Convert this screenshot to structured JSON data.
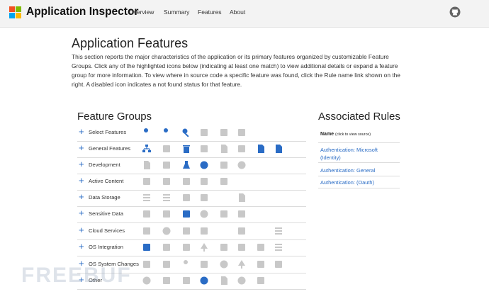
{
  "app": {
    "title": "Application Inspector",
    "nav": [
      {
        "label": "Overview"
      },
      {
        "label": "Summary"
      },
      {
        "label": "Features"
      },
      {
        "label": "About"
      }
    ],
    "logo_colors": [
      "#f25022",
      "#7fba00",
      "#00a4ef",
      "#ffb900"
    ]
  },
  "page": {
    "title": "Application Features",
    "intro": "This section reports the major characteristics of the application or its primary features organized by customizable Feature Groups. Click any of the highlighted icons below (indicating at least one match) to view additional details or expand a feature group for more information. To view where in source code a specific feature was found, click the Rule name link shown on the right. A disabled icon indicates a not found status for that feature."
  },
  "feature_groups": {
    "title": "Feature Groups",
    "expand_symbol": "+",
    "active_color": "#2a6cc5",
    "disabled_color": "#c8c8c8",
    "rows": [
      {
        "label": "Select Features",
        "icons": [
          "user-shield-icon",
          "user-lock-icon",
          "key-icon",
          "devices-icon",
          "screens-icon",
          "wireless-icon"
        ],
        "active": [
          1,
          1,
          1,
          0,
          0,
          0
        ]
      },
      {
        "label": "General Features",
        "icons": [
          "network-icon",
          "edit-icon",
          "trash-icon",
          "branch-icon",
          "file-icon",
          "window-icon",
          "file-code-icon",
          "document-icon"
        ],
        "active": [
          1,
          0,
          1,
          0,
          0,
          0,
          1,
          1
        ]
      },
      {
        "label": "Development",
        "icons": [
          "book-icon",
          "code-icon",
          "test-tube-icon",
          "github-icon",
          "plus-box-icon",
          "wordpress-icon"
        ],
        "active": [
          0,
          0,
          1,
          1,
          0,
          0
        ]
      },
      {
        "label": "Active Content",
        "icons": [
          "font-icon",
          "html5-icon",
          "plugin-icon",
          "image-icon",
          "transfer-icon"
        ],
        "active": [
          0,
          0,
          0,
          0,
          0
        ]
      },
      {
        "label": "Data Storage",
        "icons": [
          "table-icon",
          "database-icon",
          "branch-icon",
          "map-icon",
          "cloud-upload-icon",
          "file-icon"
        ],
        "active": [
          0,
          0,
          0,
          0,
          1,
          0
        ]
      },
      {
        "label": "Sensitive Data",
        "icons": [
          "id-card-icon",
          "stethoscope-icon",
          "bank-icon",
          "face-icon",
          "money-icon",
          "cart-icon"
        ],
        "active": [
          0,
          0,
          1,
          0,
          0,
          0
        ]
      },
      {
        "label": "Cloud Services",
        "icons": [
          "server-icon",
          "globe-icon",
          "facebook-icon",
          "archive-icon",
          "cloud-group-icon",
          "transfer-icon",
          "cloud-download-icon",
          "storage-icon"
        ],
        "active": [
          0,
          0,
          0,
          0,
          0,
          0,
          1,
          0
        ]
      },
      {
        "label": "OS Integration",
        "icons": [
          "linux-icon",
          "tools-off-icon",
          "shield-icon",
          "tree-icon",
          "binoculars-icon",
          "gears-icon",
          "runner-icon",
          "server-rack-icon"
        ],
        "active": [
          1,
          0,
          0,
          0,
          0,
          0,
          0,
          0
        ]
      },
      {
        "label": "OS System Changes",
        "icons": [
          "send-icon",
          "id-icon",
          "user-add-icon",
          "pencil-icon",
          "chrome-icon",
          "tree-icon",
          "wrench-icon",
          "unlock-icon"
        ],
        "active": [
          0,
          0,
          0,
          0,
          0,
          0,
          0,
          0
        ]
      },
      {
        "label": "Other",
        "icons": [
          "play-icon",
          "flag-icon",
          "tag-icon",
          "rocket-icon",
          "file-icon",
          "clock-icon",
          "fire-icon"
        ],
        "active": [
          0,
          0,
          0,
          1,
          0,
          0,
          0
        ]
      }
    ]
  },
  "associated_rules": {
    "title": "Associated Rules",
    "header_label": "Name",
    "header_hint": "(click to view source)",
    "rules": [
      {
        "label": "Authentication: Microsoft (Identity)"
      },
      {
        "label": "Authentication: General"
      },
      {
        "label": "Authentication: (Oauth)"
      }
    ]
  },
  "watermark": "FREEBUF"
}
